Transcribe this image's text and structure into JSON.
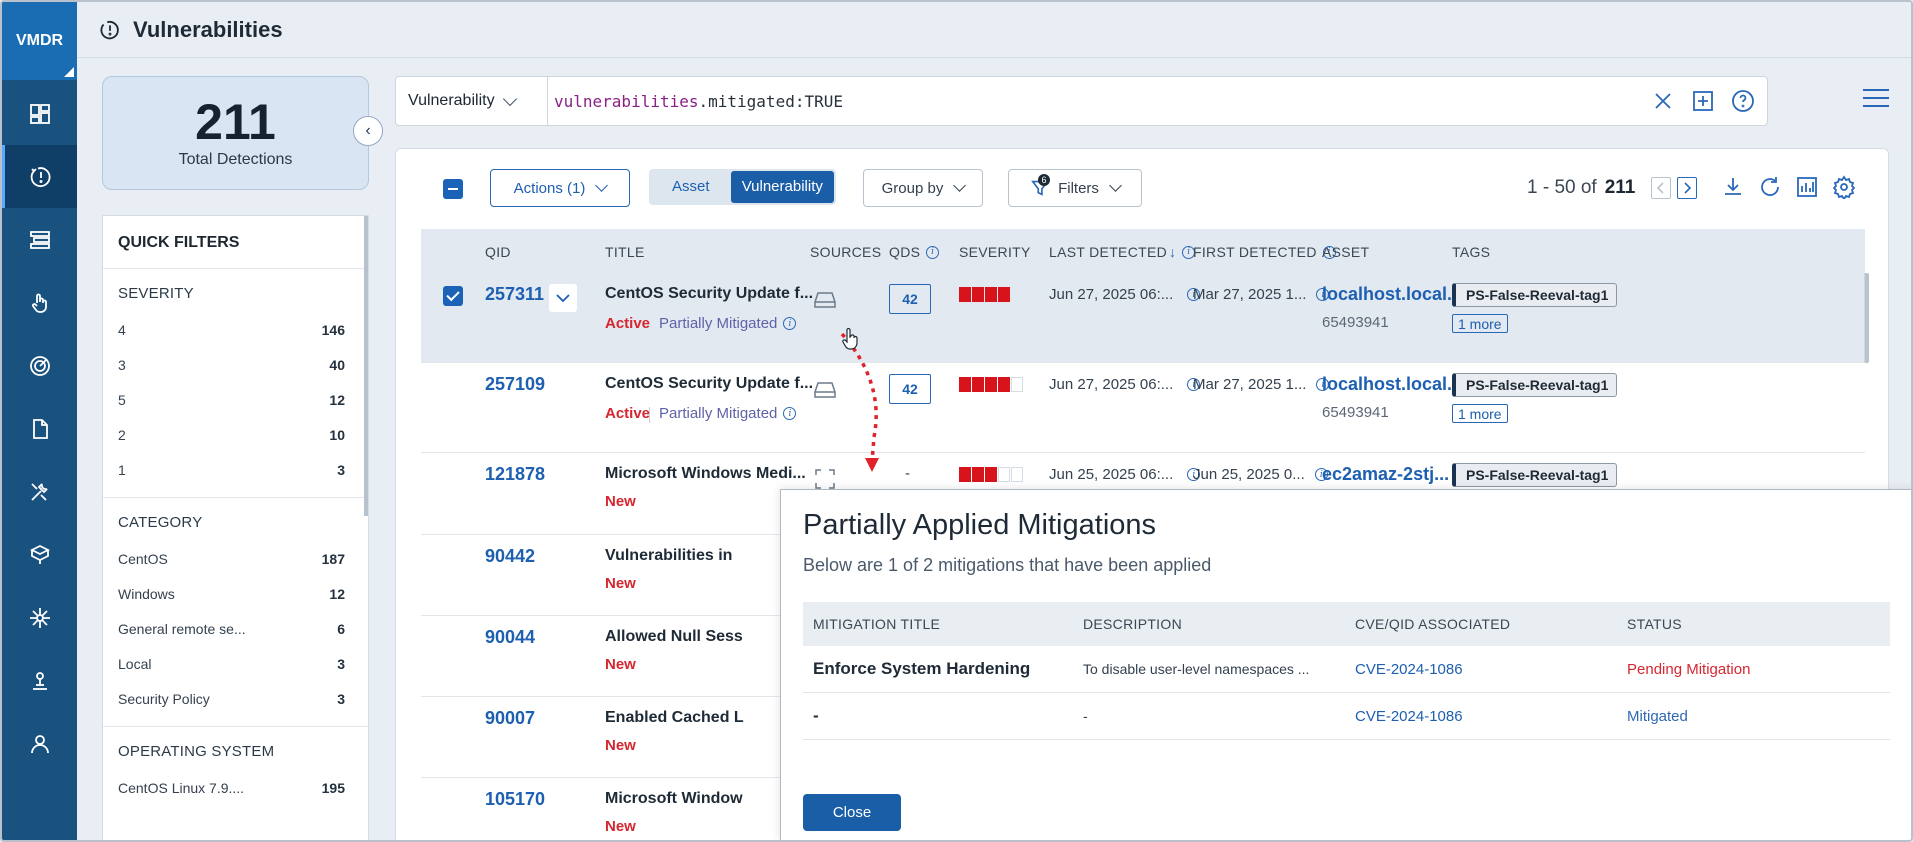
{
  "nav": {
    "brand": "VMDR",
    "items": [
      "dashboard-icon",
      "vulnerabilities-icon",
      "prioritization-icon",
      "remediation-icon",
      "threat-feed-icon",
      "reports-icon",
      "tools-icon",
      "assets-icon",
      "network-icon",
      "patch-icon",
      "users-icon"
    ]
  },
  "header": {
    "title": "Vulnerabilities"
  },
  "summary": {
    "total": "211",
    "total_label": "Total Detections"
  },
  "quick_filters": {
    "title": "QUICK FILTERS",
    "severity": {
      "label": "SEVERITY",
      "items": [
        {
          "label": "4",
          "count": "146"
        },
        {
          "label": "3",
          "count": "40"
        },
        {
          "label": "5",
          "count": "12"
        },
        {
          "label": "2",
          "count": "10"
        },
        {
          "label": "1",
          "count": "3"
        }
      ]
    },
    "category": {
      "label": "CATEGORY",
      "items": [
        {
          "label": "CentOS",
          "count": "187"
        },
        {
          "label": "Windows",
          "count": "12"
        },
        {
          "label": "General remote se...",
          "count": "6"
        },
        {
          "label": "Local",
          "count": "3"
        },
        {
          "label": "Security Policy",
          "count": "3"
        }
      ]
    },
    "os": {
      "label": "OPERATING SYSTEM",
      "items": [
        {
          "label": "CentOS Linux 7.9....",
          "count": "195"
        }
      ]
    }
  },
  "search": {
    "type": "Vulnerability",
    "query_key": "vulnerabilities",
    "query_rest": ".mitigated:TRUE"
  },
  "toolbar": {
    "actions": "Actions (1)",
    "toggle_asset": "Asset",
    "toggle_vuln": "Vulnerability",
    "group_by": "Group by",
    "filters": "Filters",
    "filters_count": "6",
    "pager_range": "1 - 50 of",
    "pager_total": "211"
  },
  "columns": {
    "qid": "QID",
    "title": "TITLE",
    "sources": "SOURCES",
    "qds": "QDS",
    "severity": "SEVERITY",
    "last": "LAST DETECTED",
    "first": "FIRST DETECTED",
    "asset": "ASSET",
    "tags": "TAGS"
  },
  "rows": [
    {
      "qid": "257311",
      "title": "CentOS Security Update f...",
      "status": "Active",
      "mit": "Partially Mitigated",
      "qds": "42",
      "sev": 4,
      "last": "Jun 27, 2025 06:...",
      "first": "Mar 27, 2025 1...",
      "asset": "localhost.local...",
      "asset_id": "65493941",
      "tag": "PS-False-Reeval-tag1",
      "more": "1 more"
    },
    {
      "qid": "257109",
      "title": "CentOS Security Update f...",
      "status": "Active",
      "mit": "Partially Mitigated",
      "qds": "42",
      "sev": 4,
      "last": "Jun 27, 2025 06:...",
      "first": "Mar 27, 2025 1...",
      "asset": "localhost.local...",
      "asset_id": "65493941",
      "tag": "PS-False-Reeval-tag1",
      "more": "1 more"
    },
    {
      "qid": "121878",
      "title": "Microsoft Windows Medi...",
      "status": "New",
      "qds": "-",
      "sev": 3,
      "last": "Jun 25, 2025 06:...",
      "first": "Jun 25, 2025 0...",
      "asset": "ec2amaz-2stj...",
      "tag": "PS-False-Reeval-tag1"
    },
    {
      "qid": "90442",
      "title": "Vulnerabilities in",
      "status": "New"
    },
    {
      "qid": "90044",
      "title": "Allowed Null Sess",
      "status": "New"
    },
    {
      "qid": "90007",
      "title": "Enabled Cached L",
      "status": "New"
    },
    {
      "qid": "105170",
      "title": "Microsoft Window",
      "status": "New"
    }
  ],
  "modal": {
    "title": "Partially Applied Mitigations",
    "subtitle": "Below are 1 of 2 mitigations that have been applied",
    "headers": [
      "MITIGATION TITLE",
      "DESCRIPTION",
      "CVE/QID ASSOCIATED",
      "STATUS"
    ],
    "rows": [
      {
        "title": "Enforce System Hardening",
        "desc": "To disable user-level namespaces ...",
        "cve": "CVE-2024-1086",
        "status": "Pending Mitigation"
      },
      {
        "title": "-",
        "desc": "-",
        "cve": "CVE-2024-1086",
        "status": "Mitigated"
      }
    ],
    "close": "Close"
  }
}
